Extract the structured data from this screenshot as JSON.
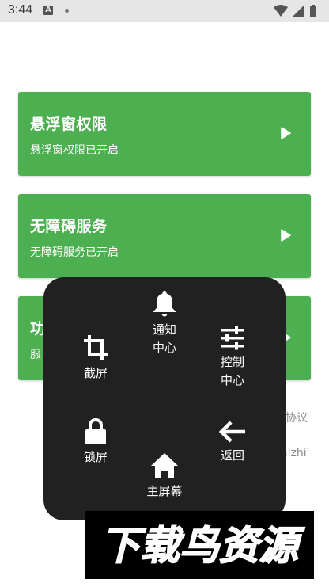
{
  "status_bar": {
    "time": "3:44",
    "notification_icon": "A"
  },
  "cards": [
    {
      "title": "悬浮窗权限",
      "subtitle": "悬浮窗权限已开启"
    },
    {
      "title": "无障碍服务",
      "subtitle": "无障碍服务已开启"
    },
    {
      "title": "功",
      "subtitle": "服"
    }
  ],
  "background_text": {
    "agreement_fragment": "协议",
    "link_fragment": "aizhi'"
  },
  "panel": {
    "notification_center": "通知\n中心",
    "screenshot": "截屏",
    "control_center": "控制\n中心",
    "lock_screen": "锁屏",
    "back": "返回",
    "home_screen": "主屏幕"
  },
  "watermark": {
    "text": "下载鸟资源"
  },
  "colors": {
    "card_green": "#4caf50",
    "panel_bg": "#212121",
    "status_bar_bg": "#e6e6e6"
  }
}
